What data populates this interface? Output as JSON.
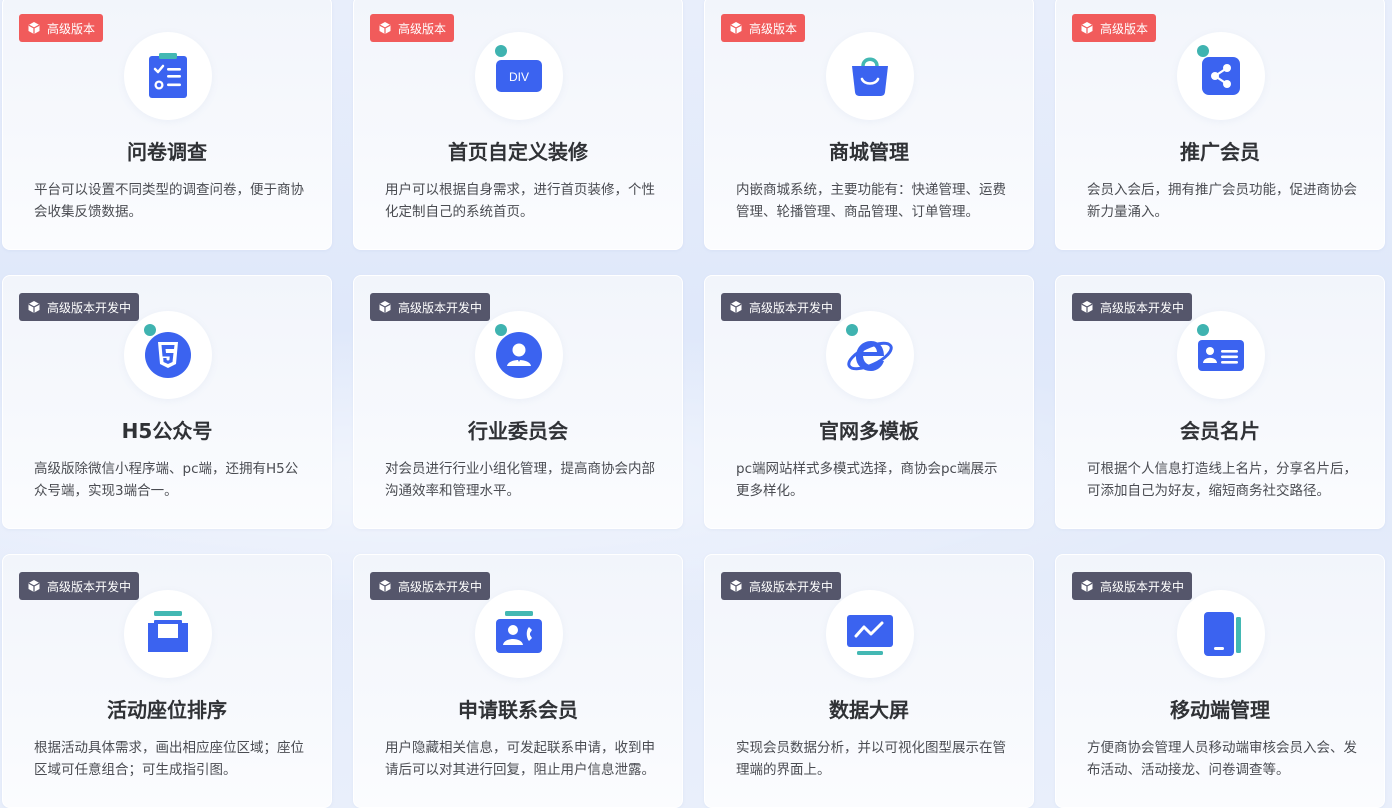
{
  "cards": [
    {
      "badge": "高级版本",
      "title": "问卷调查",
      "desc": "平台可以设置不同类型的调查问卷，便于商协会收集反馈数据。"
    },
    {
      "badge": "高级版本",
      "title": "首页自定义装修",
      "desc": "用户可以根据自身需求，进行首页装修，个性化定制自己的系统首页。",
      "icon_text": "DIV"
    },
    {
      "badge": "高级版本",
      "title": "商城管理",
      "desc": "内嵌商城系统，主要功能有：快递管理、运费管理、轮播管理、商品管理、订单管理。"
    },
    {
      "badge": "高级版本",
      "title": "推广会员",
      "desc": "会员入会后，拥有推广会员功能，促进商协会新力量涌入。"
    },
    {
      "badge": "高级版本开发中",
      "title": "H5公众号",
      "desc": "高级版除微信小程序端、pc端，还拥有H5公众号端，实现3端合一。"
    },
    {
      "badge": "高级版本开发中",
      "title": "行业委员会",
      "desc": "对会员进行行业小组化管理，提高商协会内部沟通效率和管理水平。"
    },
    {
      "badge": "高级版本开发中",
      "title": "官网多模板",
      "desc": "pc端网站样式多模式选择，商协会pc端展示更多样化。"
    },
    {
      "badge": "高级版本开发中",
      "title": "会员名片",
      "desc": "可根据个人信息打造线上名片，分享名片后，可添加自己为好友，缩短商务社交路径。"
    },
    {
      "badge": "高级版本开发中",
      "title": "活动座位排序",
      "desc": "根据活动具体需求，画出相应座位区域；座位区域可任意组合；可生成指引图。"
    },
    {
      "badge": "高级版本开发中",
      "title": "申请联系会员",
      "desc": "用户隐藏相关信息，可发起联系申请，收到申请后可以对其进行回复，阻止用户信息泄露。"
    },
    {
      "badge": "高级版本开发中",
      "title": "数据大屏",
      "desc": "实现会员数据分析，并以可视化图型展示在管理端的界面上。"
    },
    {
      "badge": "高级版本开发中",
      "title": "移动端管理",
      "desc": "方便商协会管理人员移动端审核会员入会、发布活动、活动接龙、问卷调查等。"
    }
  ]
}
